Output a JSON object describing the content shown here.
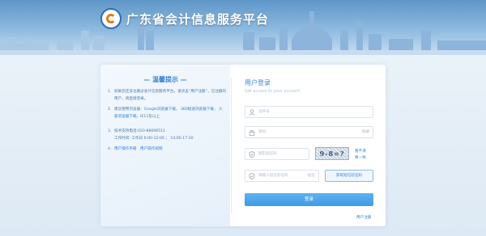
{
  "header": {
    "site_title": "广东省会计信息服务平台"
  },
  "tips": {
    "title": "— 温馨提示 —",
    "items": [
      {
        "num": "1.",
        "text": "如果您还没注册过会计信息服务平台，请点击“用户注册”，已注册的用户，请直接登录。"
      },
      {
        "num": "2.",
        "text_prefix": "建议使用浏览器：",
        "links": [
          "Google浏览器下载",
          "360极速浏览器下载",
          "火狐浏览器下载"
        ],
        "text_suffix": "，IE11及以上"
      },
      {
        "num": "3.",
        "lines": [
          "技术支持电话:020-88696511",
          "工作时间: 工作日 9:00-12:00 ； 14:00-17:30"
        ]
      },
      {
        "num": "4.",
        "links": [
          "用户操作手册",
          "用户操作视频"
        ]
      }
    ]
  },
  "login": {
    "title": "用户登录",
    "subtitle": "Get access to your account",
    "username_placeholder": "证件号",
    "password_placeholder": "密码",
    "password_suffix": "隐藏",
    "captcha_placeholder": "图形验证码",
    "captcha_text": "9-8=?",
    "captcha_change_1": "看不清",
    "captcha_change_2": "换一张",
    "sms_placeholder": "请输入短信验证码",
    "sms_suffix": "短信",
    "get_code_label": "获取短信验证码",
    "login_button": "登录",
    "register_link": "用户注册"
  },
  "icons": {
    "username": "user-icon",
    "password": "lock-icon",
    "captcha": "shield-icon",
    "sms": "shield-icon"
  },
  "colors": {
    "accent": "#3b86d6",
    "button": "#4aa3ea",
    "banner": "#6fa3d2"
  }
}
